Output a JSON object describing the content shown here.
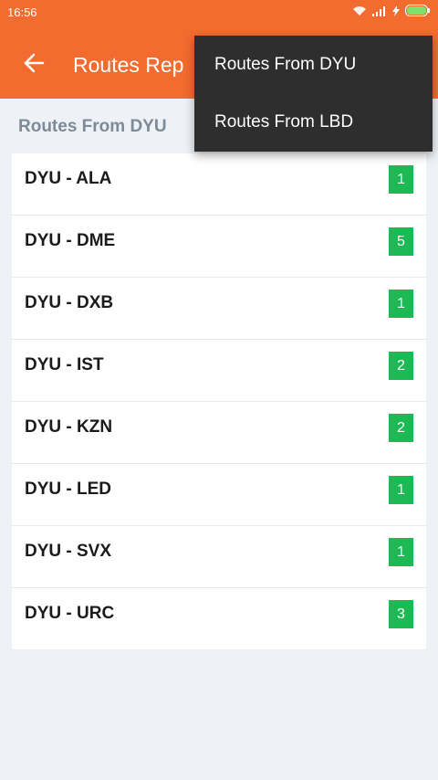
{
  "status": {
    "time": "16:56"
  },
  "appbar": {
    "title": "Routes Rep",
    "color": "#f26b2f"
  },
  "section": {
    "header": "Routes From DYU"
  },
  "routes": [
    {
      "label": "DYU - ALA",
      "count": "1"
    },
    {
      "label": "DYU - DME",
      "count": "5"
    },
    {
      "label": "DYU - DXB",
      "count": "1"
    },
    {
      "label": "DYU - IST",
      "count": "2"
    },
    {
      "label": "DYU - KZN",
      "count": "2"
    },
    {
      "label": "DYU - LED",
      "count": "1"
    },
    {
      "label": "DYU - SVX",
      "count": "1"
    },
    {
      "label": "DYU - URC",
      "count": "3"
    }
  ],
  "menu": {
    "items": [
      {
        "label": "Routes From DYU"
      },
      {
        "label": "Routes From LBD"
      }
    ]
  },
  "icons": [
    "wifi-icon",
    "signal-icon",
    "charging-icon",
    "battery-icon",
    "back-arrow-icon"
  ],
  "colors": {
    "badge": "#1db954",
    "menu_bg": "#2e2e2e"
  }
}
